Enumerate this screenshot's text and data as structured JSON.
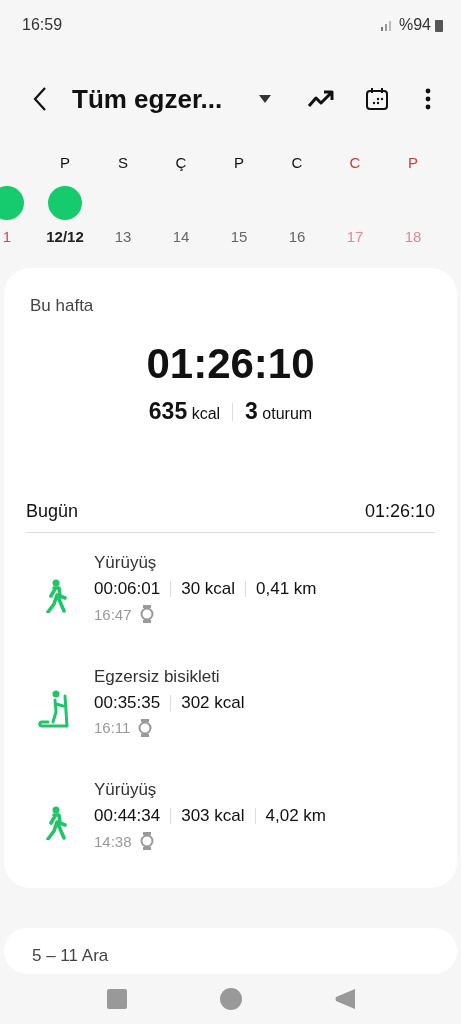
{
  "status_bar": {
    "time": "16:59",
    "battery": "%94"
  },
  "header": {
    "title": "Tüm egzer..."
  },
  "days": [
    {
      "date": "1",
      "weekend": true,
      "future": false,
      "has_activity": true,
      "selected": false
    },
    {
      "letter": "P",
      "date": "12/12",
      "weekend": false,
      "future": false,
      "has_activity": true,
      "selected": true
    },
    {
      "letter": "S",
      "date": "13",
      "weekend": false,
      "future": false,
      "has_activity": false,
      "selected": false
    },
    {
      "letter": "Ç",
      "date": "14",
      "weekend": false,
      "future": false,
      "has_activity": false,
      "selected": false
    },
    {
      "letter": "P",
      "date": "15",
      "weekend": false,
      "future": false,
      "has_activity": false,
      "selected": false
    },
    {
      "letter": "C",
      "date": "16",
      "weekend": false,
      "future": false,
      "has_activity": false,
      "selected": false
    },
    {
      "letter": "C",
      "date": "17",
      "weekend": true,
      "future": true,
      "has_activity": false,
      "selected": false
    },
    {
      "letter": "P",
      "date": "18",
      "weekend": true,
      "future": true,
      "has_activity": false,
      "selected": false
    }
  ],
  "summary": {
    "label": "Bu hafta",
    "duration": "01:26:10",
    "kcal_value": "635",
    "kcal_unit": "kcal",
    "sessions_value": "3",
    "sessions_unit": "oturum"
  },
  "today": {
    "label": "Bugün",
    "total": "01:26:10",
    "workouts": [
      {
        "kind": "walk",
        "name": "Yürüyüş",
        "stats": [
          "00:06:01",
          "30 kcal",
          "0,41 km"
        ],
        "time": "16:47"
      },
      {
        "kind": "bike",
        "name": "Egzersiz bisikleti",
        "stats": [
          "00:35:35",
          "302 kcal"
        ],
        "time": "16:11"
      },
      {
        "kind": "walk",
        "name": "Yürüyüş",
        "stats": [
          "00:44:34",
          "303 kcal",
          "4,02 km"
        ],
        "time": "14:38"
      }
    ]
  },
  "next_week": {
    "label": "5 – 11 Ara"
  }
}
